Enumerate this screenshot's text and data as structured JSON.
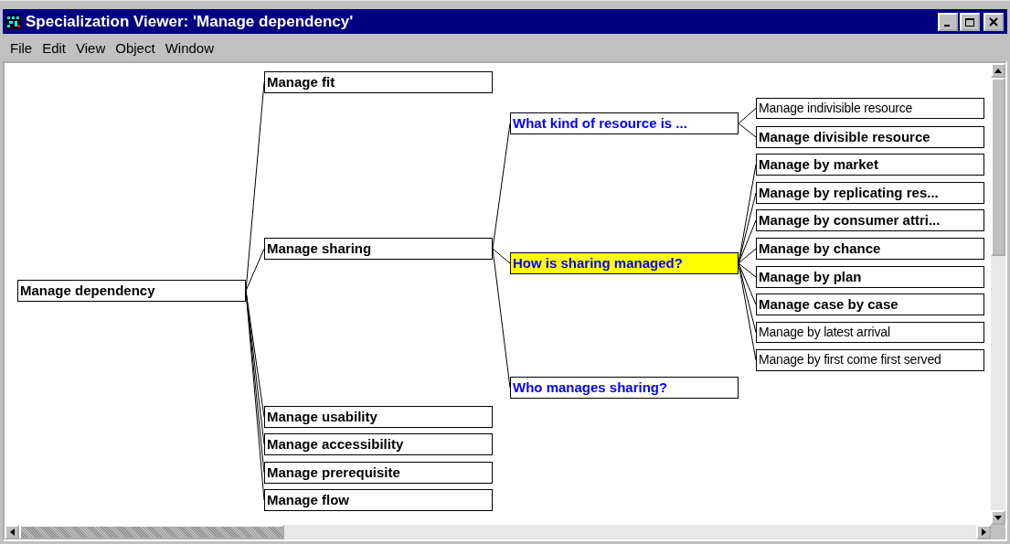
{
  "window": {
    "title": "Specialization Viewer: 'Manage dependency'"
  },
  "menu": [
    "File",
    "Edit",
    "View",
    "Object",
    "Window"
  ],
  "tree": {
    "label": "Manage dependency",
    "kind": "activity",
    "bold": true,
    "selected": false,
    "children": [
      {
        "label": "Manage fit",
        "kind": "activity",
        "bold": true,
        "selected": false
      },
      {
        "label": "Manage sharing",
        "kind": "activity",
        "bold": true,
        "selected": false,
        "children": [
          {
            "label": "What kind of resource is ...",
            "kind": "question",
            "bold": true,
            "selected": false,
            "children": [
              {
                "label": "Manage indivisible resource",
                "kind": "activity",
                "bold": false,
                "selected": false
              },
              {
                "label": "Manage divisible resource",
                "kind": "activity",
                "bold": true,
                "selected": false
              }
            ]
          },
          {
            "label": "How is sharing managed?",
            "kind": "question",
            "bold": true,
            "selected": true,
            "children": [
              {
                "label": "Manage by market",
                "kind": "activity",
                "bold": true,
                "selected": false
              },
              {
                "label": "Manage by replicating res...",
                "kind": "activity",
                "bold": true,
                "selected": false
              },
              {
                "label": "Manage by consumer attri...",
                "kind": "activity",
                "bold": true,
                "selected": false
              },
              {
                "label": "Manage by chance",
                "kind": "activity",
                "bold": true,
                "selected": false
              },
              {
                "label": "Manage by plan",
                "kind": "activity",
                "bold": true,
                "selected": false
              },
              {
                "label": "Manage case by case",
                "kind": "activity",
                "bold": true,
                "selected": false
              },
              {
                "label": "Manage by latest arrival",
                "kind": "activity",
                "bold": false,
                "selected": false
              },
              {
                "label": "Manage by first come first served",
                "kind": "activity",
                "bold": false,
                "selected": false
              }
            ]
          },
          {
            "label": "Who manages sharing?",
            "kind": "question",
            "bold": true,
            "selected": false
          }
        ]
      },
      {
        "label": "Manage usability",
        "kind": "activity",
        "bold": true,
        "selected": false
      },
      {
        "label": "Manage accessibility",
        "kind": "activity",
        "bold": true,
        "selected": false
      },
      {
        "label": "Manage prerequisite",
        "kind": "activity",
        "bold": true,
        "selected": false
      },
      {
        "label": "Manage flow",
        "kind": "activity",
        "bold": true,
        "selected": false
      }
    ]
  }
}
